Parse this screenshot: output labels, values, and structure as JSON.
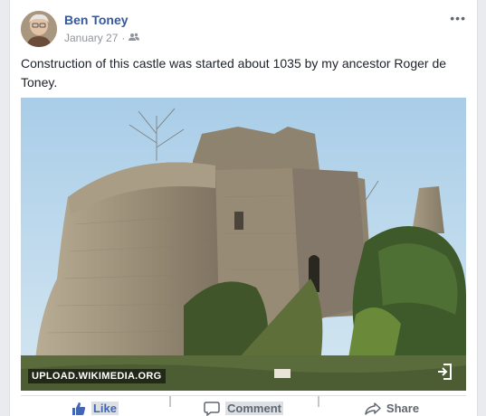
{
  "post": {
    "author": "Ben Toney",
    "date": "January 27",
    "audience_icon": "friends-icon",
    "more_label": "•••",
    "text": "Construction of this castle was started about 1035 by my ancestor Roger de Toney.",
    "link_source": "UPLOAD.WIKIMEDIA.ORG"
  },
  "actions": {
    "like": "Like",
    "comment": "Comment",
    "share": "Share"
  },
  "colors": {
    "author_link": "#365899",
    "like_blue": "#4267b2",
    "muted": "#90949c"
  }
}
